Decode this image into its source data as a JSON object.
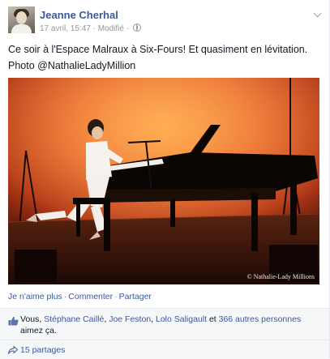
{
  "post": {
    "author": "Jeanne Cherhal",
    "timestamp": "17 avril, 15:47",
    "meta_sep": " · ",
    "edited_label": "Modifié",
    "meta_sep2": " · ",
    "text_line1": "Ce soir à l'Espace Malraux à Six-Fours! Et quasiment en lévitation.",
    "text_line2": "Photo @NathalieLadyMillion",
    "photo_credit": "© Nathalie-Lady Millions"
  },
  "actions": {
    "unlike": "Je n'aime plus",
    "sep": "·",
    "comment": "Commenter",
    "share": "Partager"
  },
  "likes": {
    "prefix": "Vous, ",
    "friend1": "Stéphane Caillé",
    "comma1": ", ",
    "friend2": "Joe Feston",
    "comma2": ", ",
    "friend3": "Lolo Saligault",
    "and": " et ",
    "others": "366 autres personnes",
    "suffix": " aimez ça."
  },
  "shares": {
    "label": "15 partages"
  },
  "icons": {
    "options": "chevron-down-icon",
    "privacy": "globe-icon",
    "like": "thumbs-up-icon",
    "shares": "share-arrow-icon"
  },
  "colors": {
    "link": "#3b5998",
    "muted": "#9197a3",
    "stage": "#e8632a"
  }
}
